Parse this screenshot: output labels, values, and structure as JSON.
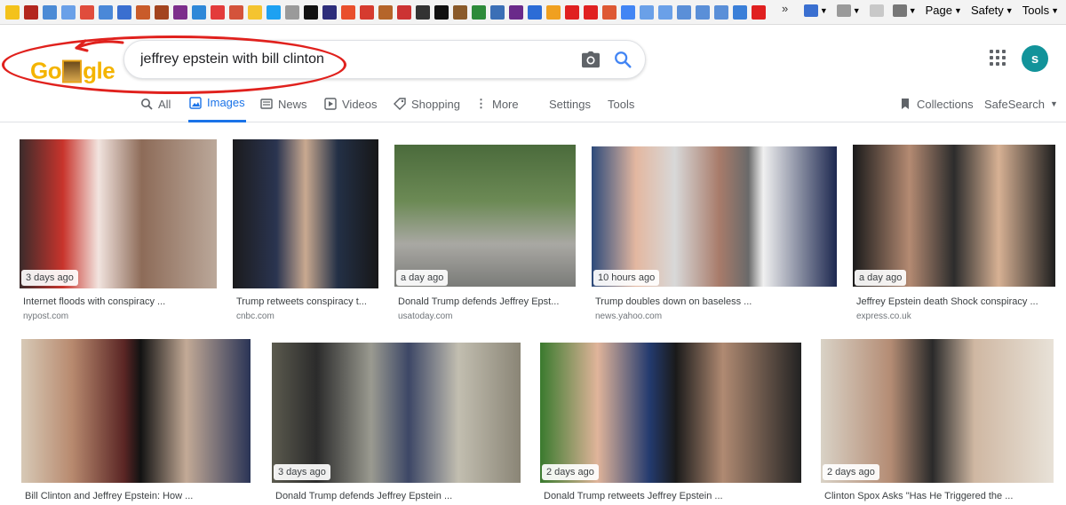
{
  "browser_bar": {
    "overflow": "»",
    "menus": [
      {
        "label": "Page"
      },
      {
        "label": "Safety"
      },
      {
        "label": "Tools"
      }
    ]
  },
  "header": {
    "logo_letters": [
      "G",
      "o",
      "g",
      "l",
      "e"
    ],
    "search_query": "jeffrey epstein with bill clinton",
    "avatar_letter": "s"
  },
  "tabs": [
    {
      "label": "All",
      "icon": "search-icon"
    },
    {
      "label": "Images",
      "icon": "image-icon",
      "active": true
    },
    {
      "label": "News",
      "icon": "newspaper-icon"
    },
    {
      "label": "Videos",
      "icon": "play-icon"
    },
    {
      "label": "Shopping",
      "icon": "tag-icon"
    },
    {
      "label": "More",
      "icon": "more-vert-icon"
    },
    {
      "label": "Settings"
    },
    {
      "label": "Tools"
    },
    {
      "label": "Collections",
      "icon": "bookmark-icon"
    },
    {
      "label": "SafeSearch",
      "icon": "caret-down-icon"
    }
  ],
  "results": [
    {
      "age": "3 days ago",
      "title": "Internet floods with conspiracy ...",
      "source": "nypost.com"
    },
    {
      "age": "",
      "title": "Trump retweets conspiracy t...",
      "source": "cnbc.com"
    },
    {
      "age": "a day ago",
      "title": "Donald Trump defends Jeffrey Epst...",
      "source": "usatoday.com"
    },
    {
      "age": "10 hours ago",
      "title": "Trump doubles down on baseless ...",
      "source": "news.yahoo.com"
    },
    {
      "age": "a day ago",
      "title": "Jeffrey Epstein death Shock conspiracy ...",
      "source": "express.co.uk"
    },
    {
      "age": "",
      "title": "Bill Clinton and Jeffrey Epstein: How ...",
      "source": ""
    },
    {
      "age": "3 days ago",
      "title": "Donald Trump defends Jeffrey Epstein ...",
      "source": ""
    },
    {
      "age": "2 days ago",
      "title": "Donald Trump retweets Jeffrey Epstein ...",
      "source": ""
    },
    {
      "age": "2 days ago",
      "title": "Clinton Spox Asks \"Has He Triggered the ...",
      "source": ""
    }
  ],
  "colors": {
    "accent": "#1a73e8",
    "annotation_red": "#e0211d",
    "avatar_bg": "#12939a"
  }
}
